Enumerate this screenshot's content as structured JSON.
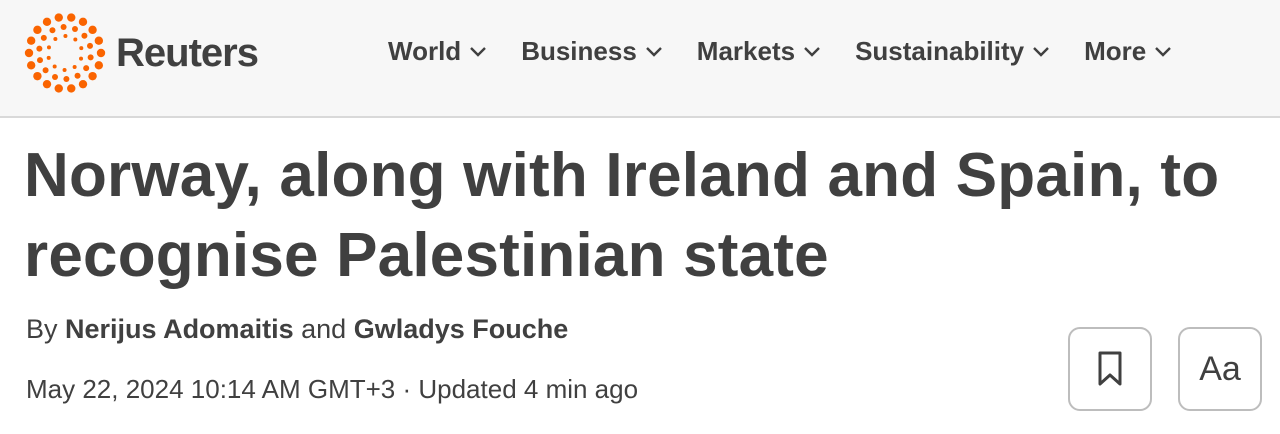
{
  "brand": {
    "name": "Reuters",
    "accent": "#fa6400"
  },
  "nav": {
    "items": [
      {
        "label": "World",
        "icon": "chevron-down-icon"
      },
      {
        "label": "Business",
        "icon": "chevron-down-icon"
      },
      {
        "label": "Markets",
        "icon": "chevron-down-icon"
      },
      {
        "label": "Sustainability",
        "icon": "chevron-down-icon"
      },
      {
        "label": "More",
        "icon": "chevron-down-icon"
      }
    ]
  },
  "article": {
    "headline": "Norway, along with Ireland and Spain, to recognise Palestinian state",
    "byline": {
      "prefix": "By",
      "author1": "Nerijus Adomaitis",
      "conjunction": "and",
      "author2": "Gwladys Fouche"
    },
    "dateline": "May 22, 2024 10:14 AM GMT+3 · Updated 4 min ago"
  },
  "tools": {
    "bookmark_icon": "bookmark-icon",
    "font_size_label": "Aa"
  }
}
